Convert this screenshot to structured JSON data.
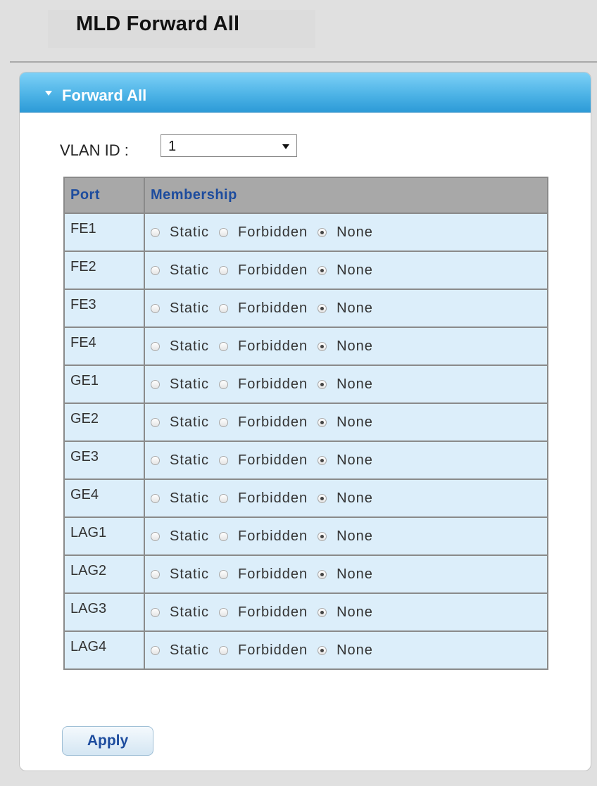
{
  "page": {
    "title": "MLD Forward All"
  },
  "panel": {
    "title": "Forward All"
  },
  "vlan": {
    "label": "VLAN ID :",
    "selected": "1"
  },
  "table": {
    "headers": {
      "port": "Port",
      "membership": "Membership"
    },
    "option_labels": {
      "static": "Static",
      "forbidden": "Forbidden",
      "none": "None"
    },
    "rows": [
      {
        "port": "FE1",
        "membership": "None"
      },
      {
        "port": "FE2",
        "membership": "None"
      },
      {
        "port": "FE3",
        "membership": "None"
      },
      {
        "port": "FE4",
        "membership": "None"
      },
      {
        "port": "GE1",
        "membership": "None"
      },
      {
        "port": "GE2",
        "membership": "None"
      },
      {
        "port": "GE3",
        "membership": "None"
      },
      {
        "port": "GE4",
        "membership": "None"
      },
      {
        "port": "LAG1",
        "membership": "None"
      },
      {
        "port": "LAG2",
        "membership": "None"
      },
      {
        "port": "LAG3",
        "membership": "None"
      },
      {
        "port": "LAG4",
        "membership": "None"
      }
    ]
  },
  "apply_label": "Apply"
}
